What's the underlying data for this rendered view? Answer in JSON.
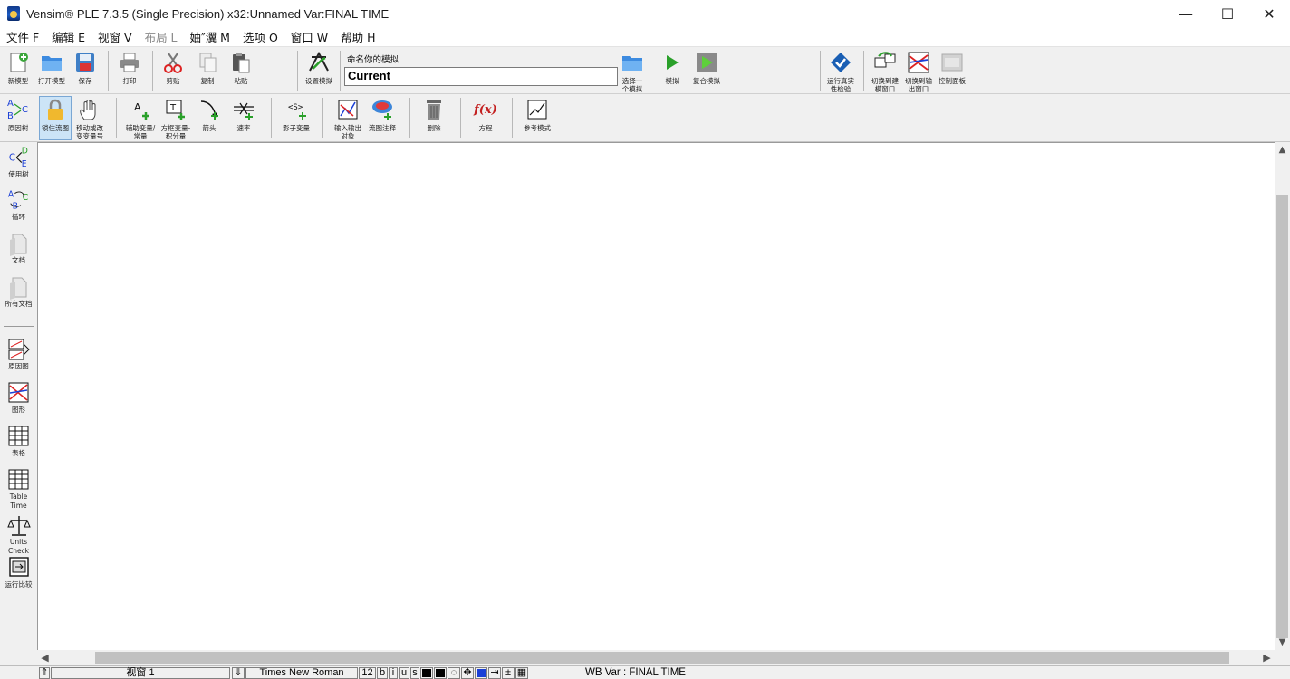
{
  "window": {
    "title": "Vensim® PLE 7.3.5 (Single Precision) x32:Unnamed Var:FINAL TIME",
    "minimize": "—",
    "maximize": "☐",
    "close": "✕"
  },
  "menu": [
    {
      "label": "文件 F",
      "enabled": true
    },
    {
      "label": "编辑 E",
      "enabled": true
    },
    {
      "label": "视窗 V",
      "enabled": true
    },
    {
      "label": "布局 L",
      "enabled": false
    },
    {
      "label": "妯″瀷 M",
      "enabled": true
    },
    {
      "label": "选项 O",
      "enabled": true
    },
    {
      "label": "窗口 W",
      "enabled": true
    },
    {
      "label": "帮助 H",
      "enabled": true
    }
  ],
  "toolbar_top": {
    "new_model": "新模型",
    "open_model": "打开模型",
    "save": "保存",
    "print": "打印",
    "cut": "剪贴",
    "copy": "复制",
    "paste": "粘贴",
    "set_simulation": "设置模拟",
    "run_name_caption": "命名你的模拟",
    "run_name_value": "Current",
    "choose_run_l1": "选择一",
    "choose_run_l2": "个模拟",
    "simulate": "模拟",
    "synthesim": "复合模拟",
    "reality_check_l1": "运行真实",
    "reality_check_l2": "性检验",
    "to_build_l1": "切换到建",
    "to_build_l2": "模窗口",
    "to_output_l1": "切换到输",
    "to_output_l2": "出窗口",
    "control_panel": "控制面板"
  },
  "toolbar_sketch": {
    "causes_tree": "原因树",
    "lock": "锁住流图",
    "move_l1": "移动或改",
    "move_l2": "变变量号",
    "aux_l1": "辅助变量/",
    "aux_l2": "常量",
    "level_l1": "方框变量-",
    "level_l2": "积分量",
    "arrow": "箭头",
    "rate": "速率",
    "shadow": "影子变量",
    "io_l1": "输入输出",
    "io_l2": "对象",
    "comment": "流图注释",
    "delete": "删除",
    "equations": "方程",
    "reference_mode": "参考模式",
    "fx_glyph": "f(x)",
    "shadow_glyph": "<S>"
  },
  "left_tools": {
    "causes_tree": "原因树",
    "uses_tree": "使用树",
    "loops": "循环",
    "document": "文档",
    "document_all": "所有文档",
    "causes_strip": "原因图",
    "graph": "图形",
    "table": "表格",
    "table_time_l1": "Table",
    "table_time_l2": "Time",
    "units_check_l1": "Units",
    "units_check_l2": "Check",
    "run_compare": "运行比较"
  },
  "status": {
    "view_name": "视窗 1",
    "font_name": "Times New Roman",
    "font_size": "12",
    "bold": "b",
    "italic": "i",
    "underline": "u",
    "strike": "s",
    "workbench_var": "WB Var : FINAL TIME"
  },
  "colors": {
    "accent_blue": "#1a3fd6",
    "green_play": "#2aa02a",
    "canvas": "#ffffff"
  }
}
